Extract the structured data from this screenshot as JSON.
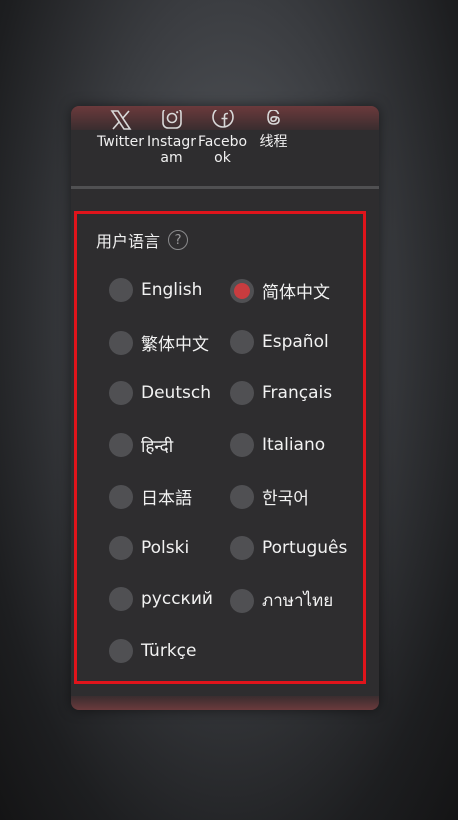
{
  "social": [
    {
      "name": "twitter",
      "label": "Twitter",
      "icon": "x-twitter-icon"
    },
    {
      "name": "instagram",
      "label": "Instagram",
      "icon": "instagram-icon"
    },
    {
      "name": "facebook",
      "label": "Facebook",
      "icon": "facebook-icon"
    },
    {
      "name": "threads",
      "label": "线程",
      "icon": "threads-icon"
    }
  ],
  "language_section": {
    "title": "用户语言",
    "help_icon": "?",
    "selected": "简体中文",
    "options": [
      {
        "label": "English",
        "selected": false
      },
      {
        "label": "简体中文",
        "selected": true
      },
      {
        "label": "繁体中文",
        "selected": false
      },
      {
        "label": "Español",
        "selected": false
      },
      {
        "label": "Deutsch",
        "selected": false
      },
      {
        "label": "Français",
        "selected": false
      },
      {
        "label": "हिन्दी",
        "selected": false
      },
      {
        "label": "Italiano",
        "selected": false
      },
      {
        "label": "日本語",
        "selected": false
      },
      {
        "label": "한국어",
        "selected": false
      },
      {
        "label": "Polski",
        "selected": false
      },
      {
        "label": "Português",
        "selected": false
      },
      {
        "label": "русский",
        "selected": false
      },
      {
        "label": "ภาษาไทย",
        "selected": false
      },
      {
        "label": "Türkçe",
        "selected": false
      }
    ]
  },
  "colors": {
    "accent": "#c83c3f",
    "highlight_border": "#e0141b",
    "panel_bg": "#2e2d2f"
  }
}
